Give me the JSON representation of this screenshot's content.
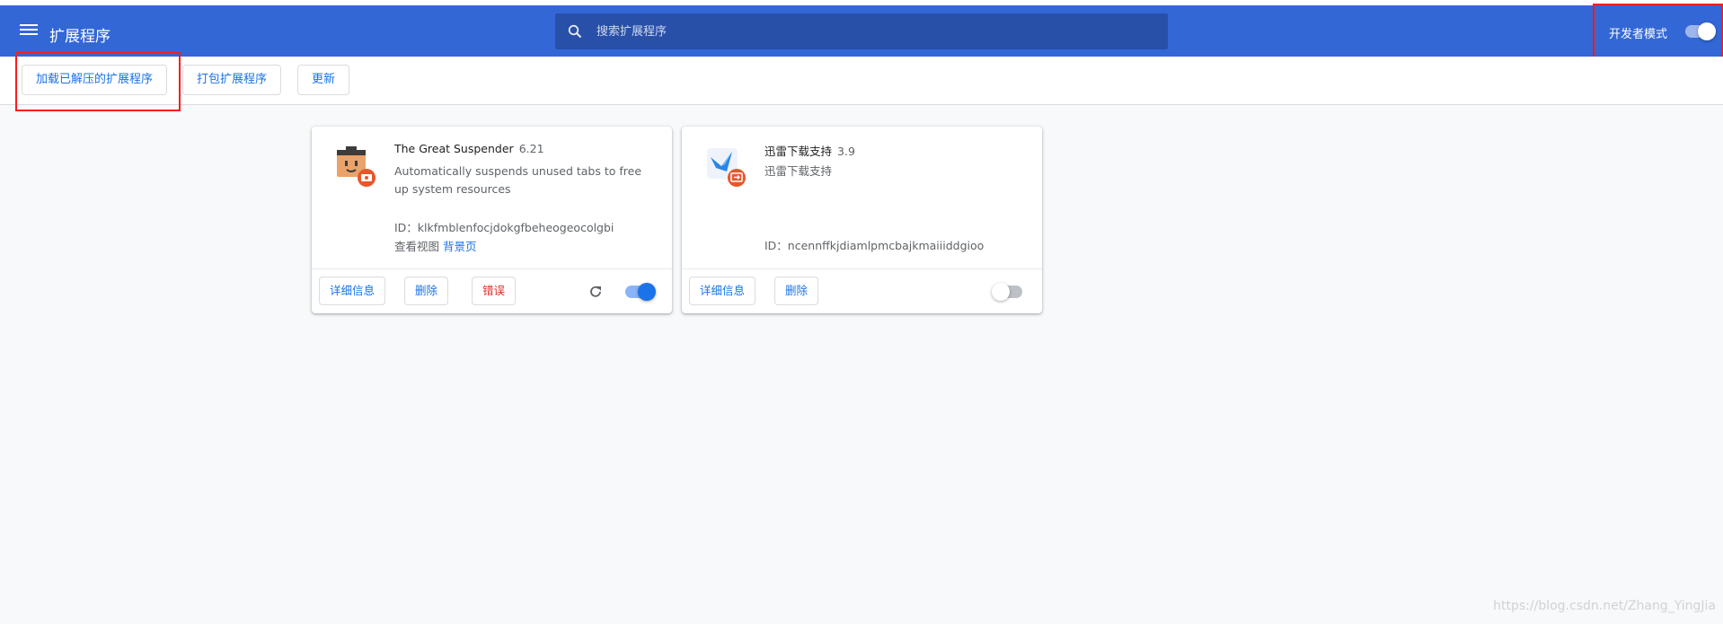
{
  "header": {
    "title": "扩展程序",
    "search_placeholder": "搜索扩展程序",
    "dev_mode_label": "开发者模式",
    "dev_mode_enabled": true
  },
  "toolbar": {
    "load_unpacked": "加载已解压的扩展程序",
    "pack": "打包扩展程序",
    "update": "更新"
  },
  "extensions": [
    {
      "name": "The Great Suspender",
      "version": "6.21",
      "description": "Automatically suspends unused tabs to free up system resources",
      "id": "ID：klkfmblenfocjdokgfbeheogeocolgbi",
      "inspect_label": "查看视图",
      "inspect_link": "背景页",
      "details": "详细信息",
      "remove": "删除",
      "errors": "错误",
      "enabled": true
    },
    {
      "name": "迅雷下载支持",
      "version": "3.9",
      "description": "迅雷下载支持",
      "id": "ID：ncennffkjdiamlpmcbajkmaiiiddgioo",
      "details": "详细信息",
      "remove": "删除",
      "enabled": false
    }
  ],
  "watermark": "https://blog.csdn.net/Zhang_YingJia",
  "colors": {
    "header": "#3367d6",
    "search_bg": "#2850a9",
    "accent": "#1a73e8",
    "error": "#d93025",
    "highlight": "#ff1a1a"
  }
}
